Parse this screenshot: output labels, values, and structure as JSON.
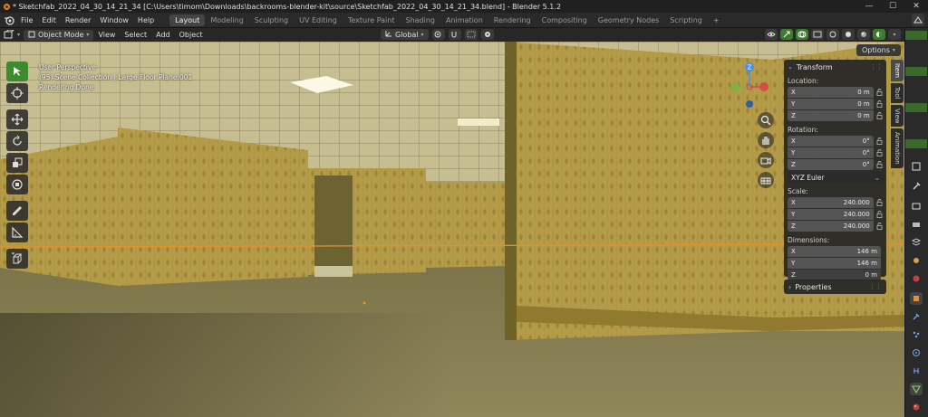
{
  "window": {
    "title": "* Sketchfab_2022_04_30_14_21_34 [C:\\Users\\timom\\Downloads\\backrooms-blender-kit\\source\\Sketchfab_2022_04_30_14_21_34.blend] - Blender 5.1.2",
    "controls": [
      "—",
      "☐",
      "✕"
    ]
  },
  "menu": [
    "File",
    "Edit",
    "Render",
    "Window",
    "Help"
  ],
  "workspaces": [
    "Layout",
    "Modeling",
    "Sculpting",
    "UV Editing",
    "Texture Paint",
    "Shading",
    "Animation",
    "Rendering",
    "Compositing",
    "Geometry Nodes",
    "Scripting"
  ],
  "workspace_add": "+",
  "active_workspace": "Layout",
  "viewport_header": {
    "mode": "Object Mode",
    "menus": [
      "View",
      "Select",
      "Add",
      "Object"
    ],
    "orientation": "Global"
  },
  "viewport": {
    "perspective": "User Perspective",
    "collection": "(95) Scene Collection | Large Floor Plane.001",
    "status": "Rendering Done",
    "options_label": "Options",
    "gizmo_labels": {
      "z": "Z",
      "y": "Y",
      "x": "X"
    }
  },
  "transform": {
    "header": "Transform",
    "location_label": "Location:",
    "location": [
      {
        "axis": "X",
        "value": "0 m"
      },
      {
        "axis": "Y",
        "value": "0 m"
      },
      {
        "axis": "Z",
        "value": "0 m"
      }
    ],
    "rotation_label": "Rotation:",
    "rotation": [
      {
        "axis": "X",
        "value": "0°"
      },
      {
        "axis": "Y",
        "value": "0°"
      },
      {
        "axis": "Z",
        "value": "0°"
      }
    ],
    "rotation_mode": "XYZ Euler",
    "scale_label": "Scale:",
    "scale": [
      {
        "axis": "X",
        "value": "240.000"
      },
      {
        "axis": "Y",
        "value": "240.000"
      },
      {
        "axis": "Z",
        "value": "240.000"
      }
    ],
    "dimensions_label": "Dimensions:",
    "dimensions": [
      {
        "axis": "X",
        "value": "146 m"
      },
      {
        "axis": "Y",
        "value": "146 m"
      },
      {
        "axis": "Z",
        "value": "0 m"
      }
    ]
  },
  "properties_panel": "Properties",
  "sidebar_tabs": [
    "Item",
    "Tool",
    "View",
    "Animation"
  ],
  "colors": {
    "accent_green": "#3f8a2f",
    "wall_yellow": "#b39b47",
    "ceiling": "#c9bf90",
    "carpet": "#8a7f4e",
    "selection_orange": "#e8902a"
  }
}
